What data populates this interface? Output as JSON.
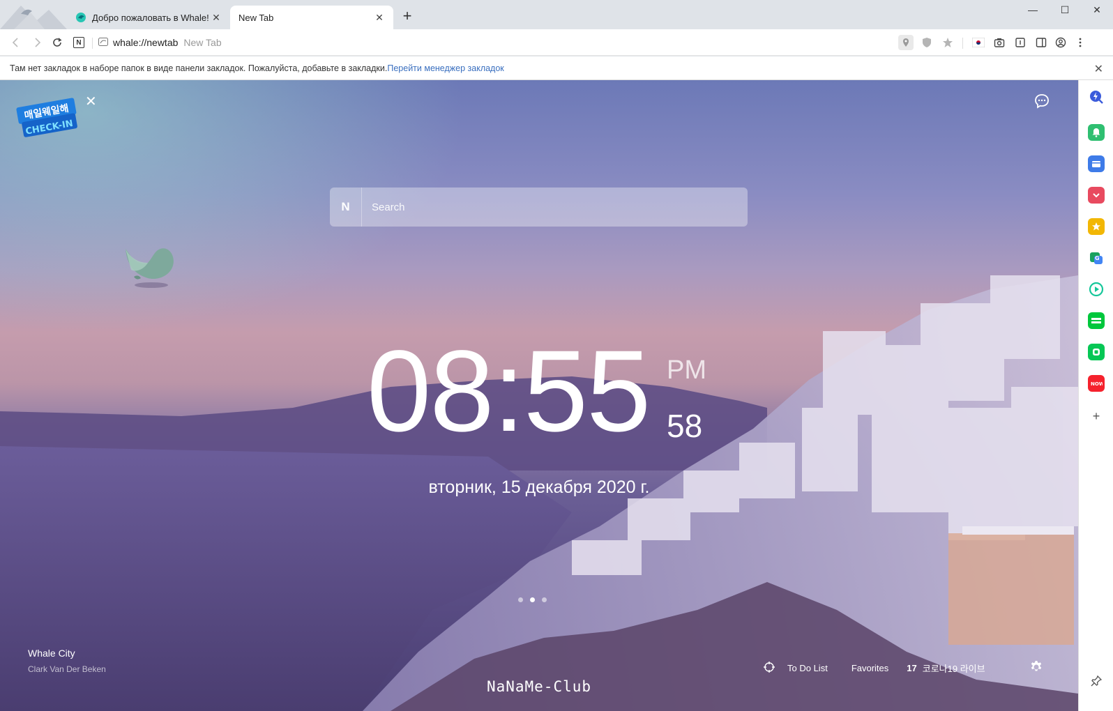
{
  "tabs": [
    {
      "title": "Добро пожаловать в Whale!",
      "close": "✕"
    },
    {
      "title": "New Tab",
      "close": "✕"
    }
  ],
  "new_tab_symbol": "+",
  "window_controls": {
    "minimize": "—",
    "maximize": "☐",
    "close": "✕"
  },
  "toolbar": {
    "url": "whale://newtab",
    "page_title": "New Tab",
    "n_button": "N"
  },
  "bookmark_bar": {
    "message": "Там нет закладок в наборе папок в виде панели закладок. Пожалуйста, добавьте в закладки.",
    "link": "Перейти менеджер закладок",
    "close": "✕"
  },
  "checkin": {
    "line1": "매일웨일해",
    "line2": "CHECK-IN",
    "close": "✕"
  },
  "search": {
    "logo": "N",
    "placeholder": "Search"
  },
  "clock": {
    "time": "08:55",
    "ampm": "PM",
    "seconds": "58"
  },
  "date": "вторник, 15 декабря 2020 г.",
  "background_credit": {
    "title": "Whale City",
    "author": "Clark Van Der Beken"
  },
  "bottom": {
    "todo": "To Do List",
    "favorites": "Favorites",
    "covid_count": "17",
    "covid_label": "코로나19 라이브"
  },
  "watermark": "NaNaMe-Club",
  "slides": {
    "count": 3,
    "active": 1
  },
  "sidebar_icons": [
    {
      "name": "whale-search-icon",
      "color": "#3b5bdb"
    },
    {
      "name": "notification-bell-icon",
      "color": "#2fbf71"
    },
    {
      "name": "wallet-icon",
      "color": "#3e7be8"
    },
    {
      "name": "pocket-icon",
      "color": "#e84a5f"
    },
    {
      "name": "favorite-star-icon",
      "color": "#f2b705"
    },
    {
      "name": "translate-icon",
      "color": "#1aa260"
    },
    {
      "name": "media-play-icon",
      "color": "#16c79a"
    },
    {
      "name": "webtoon-icon",
      "color": "#00c73c"
    },
    {
      "name": "line-icon",
      "color": "#06c755"
    },
    {
      "name": "now-icon",
      "color": "#f5222d"
    }
  ],
  "sidebar_add": "+",
  "colors": {
    "link": "#3a6fbf",
    "active_tab": "#ffffff",
    "tabstrip": "#dfe3e8"
  }
}
